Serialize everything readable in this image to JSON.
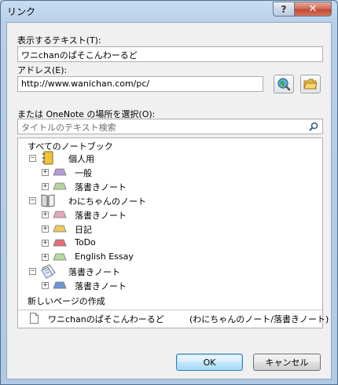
{
  "window": {
    "title": "リンク",
    "help_glyph": "?",
    "close_glyph": "✕"
  },
  "display_text": {
    "label": "表示するテキスト(T):",
    "value": "ワニchanのぱそこんわーるど"
  },
  "address": {
    "label": "アドレス(E):",
    "value": "http://www.wanichan.com/pc/"
  },
  "onenote": {
    "label": "または OneNote の場所を選択(O):",
    "search_placeholder": "タイトルのテキスト検索"
  },
  "tree": {
    "root": "すべてのノートブック",
    "notebooks": [
      {
        "name": "個人用",
        "icon": "notebook-yellow",
        "sections": [
          {
            "name": "一般",
            "color": "#b49ad6"
          },
          {
            "name": "落書きノート",
            "color": "#b6d79f"
          }
        ]
      },
      {
        "name": "わにちゃんのノート",
        "icon": "notebook-open",
        "sections": [
          {
            "name": "落書きノート",
            "color": "#e5a6bf"
          },
          {
            "name": "日記",
            "color": "#edc95f"
          },
          {
            "name": "ToDo",
            "color": "#e36d7c"
          },
          {
            "name": "English Essay",
            "color": "#b8d99d"
          }
        ]
      },
      {
        "name": "落書きノート",
        "icon": "notebook-pages",
        "sections": [
          {
            "name": "落書きノート",
            "color": "#6f96d2"
          }
        ]
      }
    ],
    "new_page": "新しいページの作成",
    "result": {
      "name": "ワニchanのぱそこんわーるど",
      "location": "(わにちゃんのノート/落書きノート)"
    }
  },
  "buttons": {
    "ok": "OK",
    "cancel": "キャンセル"
  },
  "expander_symbols": {
    "expanded": "−",
    "collapsed": "+"
  }
}
